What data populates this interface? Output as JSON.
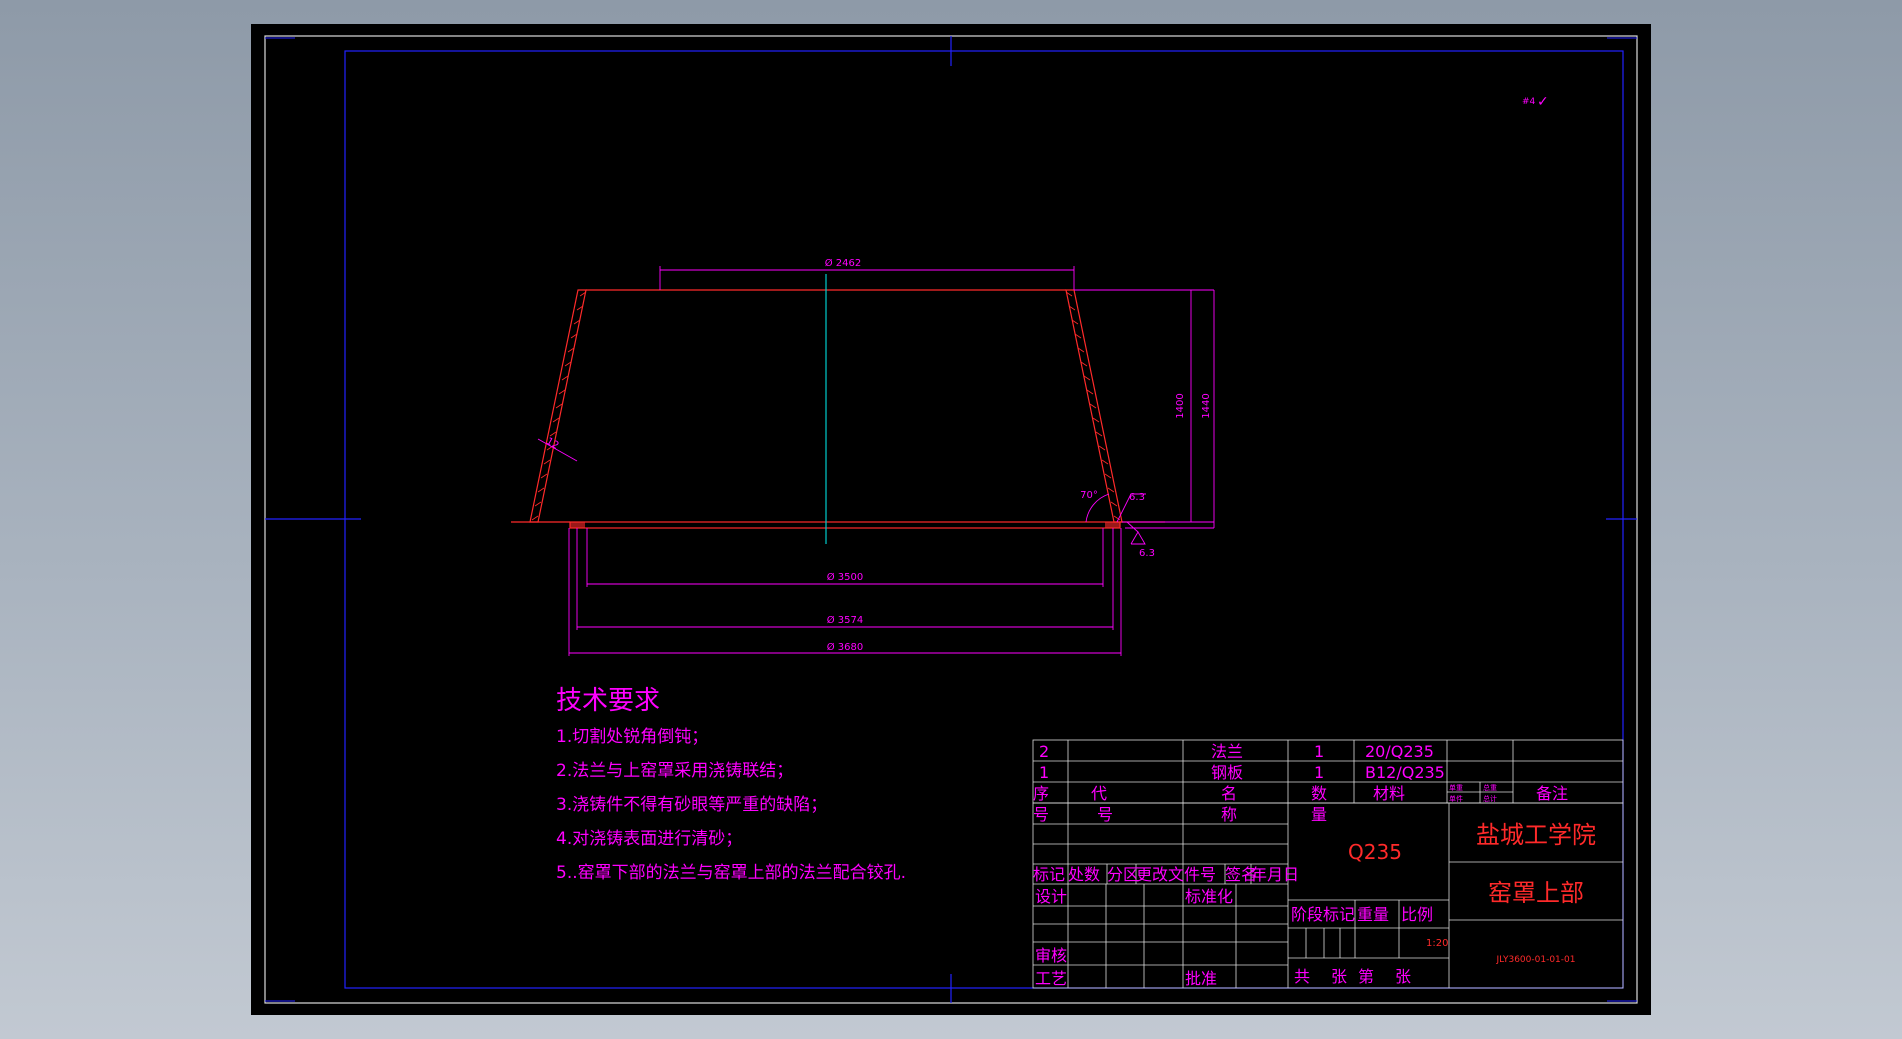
{
  "colors": {
    "background": "#9aa5b2",
    "sheet": "#000000",
    "frame": "#2222ff",
    "annotation": "#ff00ff",
    "geometry": "#ff2a2a",
    "centerline": "#00cccc",
    "dimension": "#ff00ff"
  },
  "corner_mark": "✓",
  "dimensions": {
    "top_diameter": "Ø 2462",
    "height_inner": "1400",
    "height_outer": "1440",
    "wall_thickness": "12",
    "angle": "70°",
    "weld_top": "6.3",
    "weld_bottom": "6.3",
    "diameter_3500": "Ø 3500",
    "diameter_3574": "Ø 3574",
    "diameter_3680": "Ø 3680"
  },
  "requirements": {
    "title": "技术要求",
    "items": [
      "1.切割处锐角倒钝；",
      "2.法兰与上窑罩采用浇铸联结；",
      "3.浇铸件不得有砂眼等严重的缺陷；",
      "4.对浇铸表面进行清砂；",
      "5..窑罩下部的法兰与窑罩上部的法兰配合铰孔."
    ]
  },
  "parts_list": {
    "rows": [
      {
        "no": "2",
        "code": "",
        "name": "法兰",
        "qty": "1",
        "material": "20/Q235",
        "note": ""
      },
      {
        "no": "1",
        "code": "",
        "name": "钢板",
        "qty": "1",
        "material": "B12/Q235",
        "note": ""
      }
    ],
    "header": {
      "no_top": "序",
      "no_bottom": "号",
      "code_top": "代",
      "code_bottom": "号",
      "name_top": "名",
      "name_bottom": "称",
      "qty_top": "数",
      "qty_bottom": "量",
      "material": "材料",
      "small_1": "单重",
      "small_2": "总重",
      "small_3": "单件",
      "small_4": "总计",
      "note": "备注"
    }
  },
  "title_block": {
    "material": "Q235",
    "school": "盐城工学院",
    "drawing_name": "窑罩上部",
    "drawing_number": "JLY3600-01-01-01",
    "scale": "1:20",
    "revision_headers": [
      "标记",
      "处数",
      "分区",
      "更改文件号",
      "签名",
      "年月日"
    ],
    "design": "设计",
    "standardize": "标准化",
    "review": "审核",
    "process": "工艺",
    "approve": "批准",
    "stage_mark": "阶段标记",
    "weight": "重量",
    "ratio": "比例",
    "sheets_total": "共",
    "sheets_unit": "张",
    "sheet_no": "第",
    "sheet_unit2": "张"
  }
}
